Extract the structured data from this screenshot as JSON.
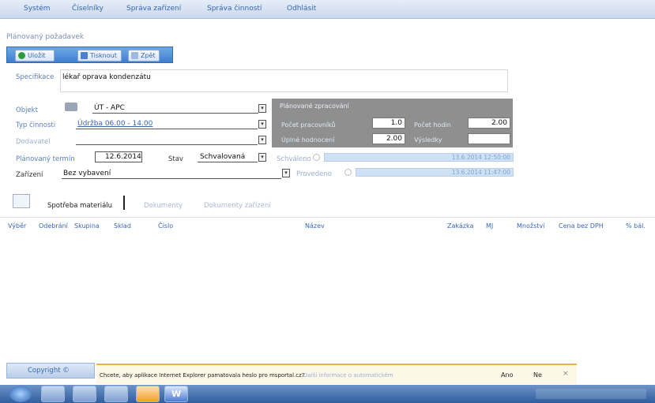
{
  "menu": [
    "Systém",
    "Číselníky",
    "Správa zařízení",
    "Správa činností",
    "Odhlásit"
  ],
  "page_title": "Plánovaný požadavek",
  "toolbar": {
    "save_label": "Uložit",
    "print_label": "Tisknout",
    "back_label": "Zpět"
  },
  "form": {
    "spec_label": "Specifikace",
    "spec_value": "lékař oprava kondenzátu",
    "object_label": "Objekt",
    "object_code": "ÚT - APC",
    "type_label": "Typ činnosti",
    "type_value": "Údržba 06.00 - 14.00",
    "supplier_label": "Dodavatel",
    "planned_label": "Plánovaný termín",
    "planned_value": "12.6.2014",
    "state_label": "Stav",
    "state_value": "Schvalovaná",
    "device_label": "Zařízení",
    "device_value": "Bez vybavení"
  },
  "panel": {
    "title": "Plánované zpracování",
    "workers_label": "Počet pracovníků",
    "workers_value": "1.0",
    "hours_label": "Počet hodin",
    "hours_value": "2.00",
    "total_label": "Úplné hodnocení",
    "total_value": "2.00",
    "other_label": "Výsledky"
  },
  "approval": {
    "approved_label": "Schváleno",
    "approved_date": "13.6.2014 12:50:00",
    "done_label": "Provedeno",
    "done_date": "13.6.2014 11:47:00"
  },
  "tabs": [
    "Spotřeba materiálu",
    "Dokumenty",
    "Dokumenty zařízení"
  ],
  "columns": [
    "Výběr",
    "Odebrání",
    "Skupina",
    "Sklad",
    "Číslo",
    "Název",
    "Zakázka",
    "MJ",
    "Množství",
    "Cena bez DPH",
    "% bál."
  ],
  "footer_label": "Copyright ©",
  "notification": {
    "message": "Chcete, aby aplikace Internet Explorer pamatovala heslo pro msportal.cz?",
    "link": "Další informace o automatickém",
    "yes": "Ano",
    "no": "Ne"
  },
  "colors": {
    "menu_text": "#3a66b0",
    "label": "#5a7fc2",
    "panel_bg": "#8f8f8f",
    "taskbar": "#2f5d9e"
  }
}
